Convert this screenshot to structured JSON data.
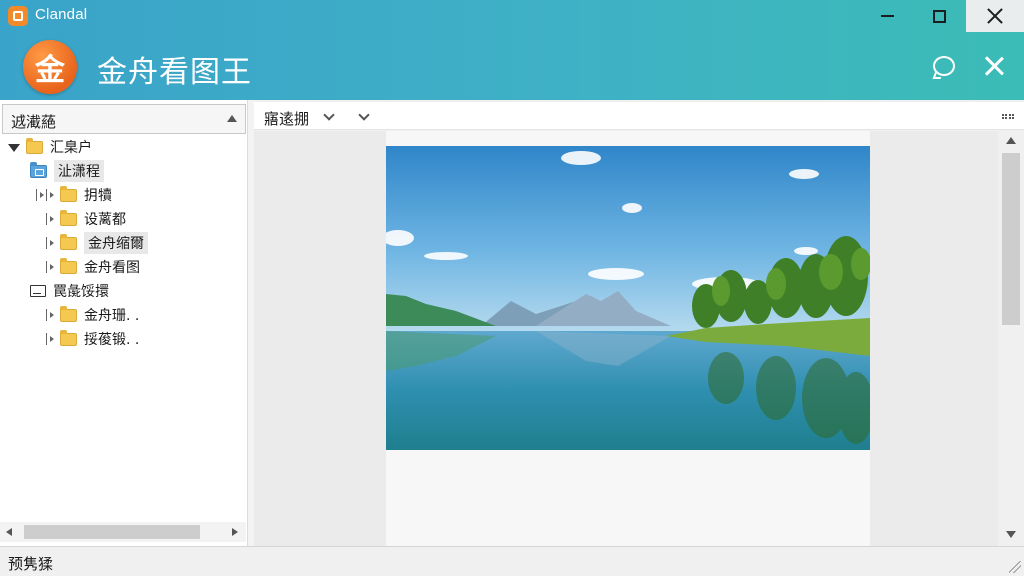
{
  "window": {
    "app_name": "Clandal",
    "controls": {
      "minimize": "minimize",
      "maximize": "maximize",
      "close": "close"
    }
  },
  "header": {
    "logo_char": "金",
    "title": "金舟看图王",
    "icons": [
      "chat-icon",
      "close-icon"
    ]
  },
  "sidebar": {
    "header_label": "䢕㵶蕝",
    "tree": [
      {
        "label": "汇臬户",
        "level": 0,
        "expanded": true,
        "icon": "folder-icon"
      },
      {
        "label": "沚潇程",
        "level": 1,
        "selected": true,
        "icon": "blue-folder-icon"
      },
      {
        "label": "抈犢",
        "level": 2,
        "icon": "folder-icon"
      },
      {
        "label": "设蓠都",
        "level": 2,
        "icon": "folder-icon"
      },
      {
        "label": "金舟缩爾",
        "level": 2,
        "icon": "folder-icon",
        "hover": true
      },
      {
        "label": "金舟看图",
        "level": 2,
        "icon": "folder-icon"
      },
      {
        "label": "罠彘馁擐",
        "level": 0,
        "expanded": true,
        "icon": "drive-icon"
      },
      {
        "label": "金舟珊. .",
        "level": 2,
        "icon": "folder-icon"
      },
      {
        "label": "挼葰锻. .",
        "level": 2,
        "icon": "folder-icon"
      }
    ]
  },
  "viewer": {
    "toolbar_label": "寤逺掤"
  },
  "status": {
    "text": "预隽猱"
  }
}
